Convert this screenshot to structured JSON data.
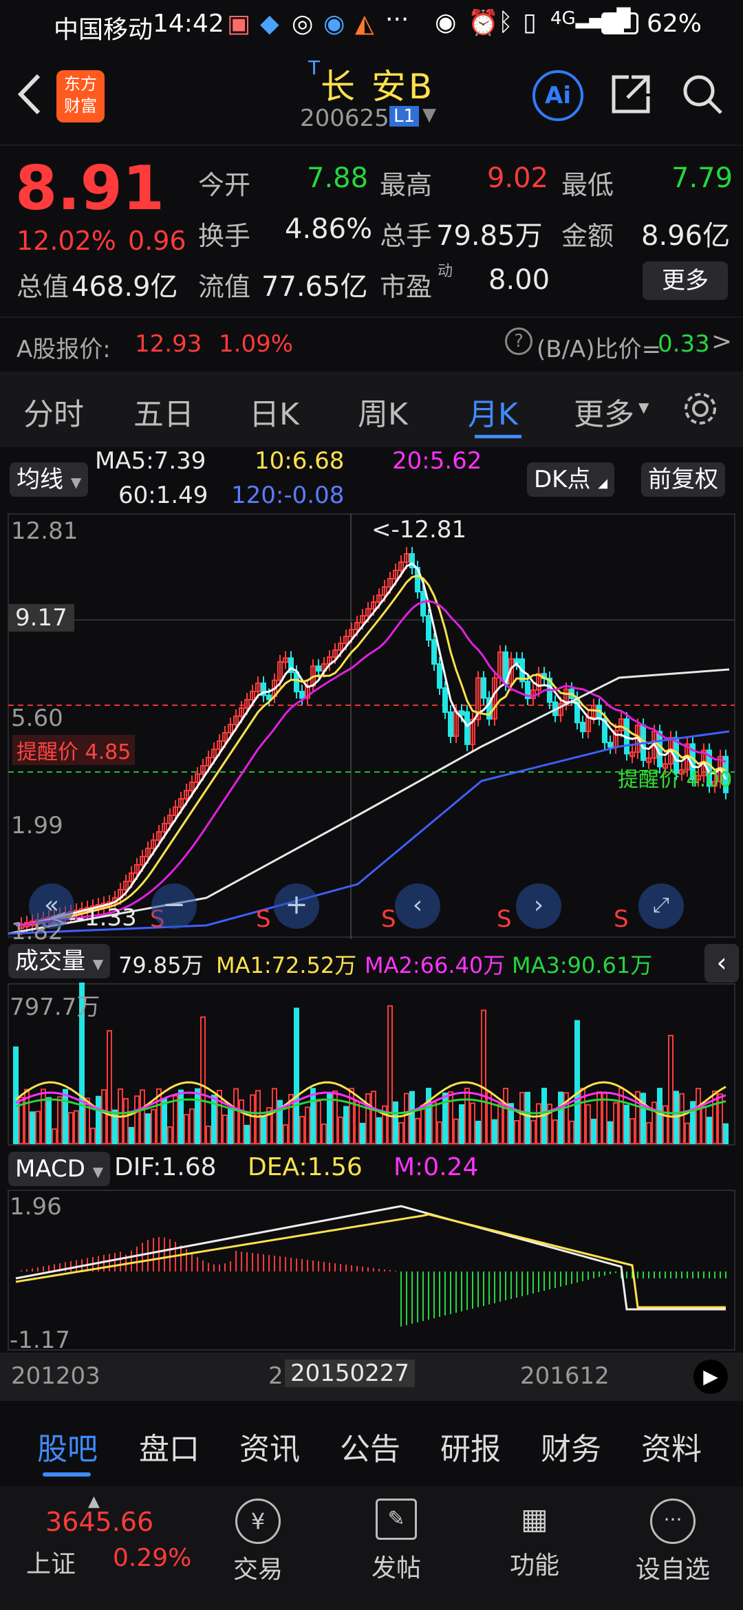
{
  "status": {
    "carrier": "中国移动",
    "time": "14:42",
    "battery": "62%"
  },
  "header": {
    "logo_line1": "东方",
    "logo_line2": "财富",
    "title": "长 安B",
    "title_prefix": "T",
    "code": "200625",
    "board": "L1",
    "ai_label": "Ai"
  },
  "quote": {
    "price": "8.91",
    "pct": "12.02%",
    "chg": "0.96",
    "open_label": "今开",
    "open": "7.88",
    "high_label": "最高",
    "high": "9.02",
    "low_label": "最低",
    "low": "7.79",
    "turnover_label": "换手",
    "turnover": "4.86%",
    "vol_label": "总手",
    "vol": "79.85万",
    "amount_label": "金额",
    "amount": "8.96亿",
    "mcap_label": "总值",
    "mcap": "468.9亿",
    "float_label": "流值",
    "float": "77.65亿",
    "pe_label": "市盈",
    "pe_sup": "动",
    "pe": "8.00",
    "more": "更多",
    "a_label": "A股报价:",
    "a_price": "12.93",
    "a_pct": "1.09%",
    "ba_label": "(B/A)比价=",
    "ba_value": "0.33"
  },
  "tabs": [
    "分时",
    "五日",
    "日K",
    "周K",
    "月K",
    "更多"
  ],
  "active_tab": "月K",
  "ma": {
    "chip": "均线",
    "ma5": "MA5:7.39",
    "ma10": "10:6.68",
    "ma20": "20:5.62",
    "ma60": "60:1.49",
    "ma120": "120:-0.08",
    "dk": "DK点",
    "fq": "前复权"
  },
  "kchart": {
    "y1": "12.81",
    "y2": "9.17",
    "y3": "5.60",
    "y4": "1.99",
    "y5": "1.82",
    "max_label": "<-12.81",
    "min_label": "<--1.33",
    "alert_red": "提醒价 4.85",
    "alert_green": "提醒价 4.00",
    "s": "S"
  },
  "volume": {
    "chip": "成交量",
    "v": "79.85万",
    "ma1": "MA1:72.52万",
    "ma2": "MA2:66.40万",
    "ma3": "MA3:90.61万",
    "ymax": "797.7万"
  },
  "macd": {
    "chip": "MACD",
    "dif": "DIF:1.68",
    "dea": "DEA:1.56",
    "m": "M:0.24",
    "ymax": "1.96",
    "ymin": "-1.17"
  },
  "xaxis": {
    "d1": "201203",
    "d2": "2",
    "d3": "20150227",
    "d4": "201612"
  },
  "bottom_tabs": [
    "股吧",
    "盘口",
    "资讯",
    "公告",
    "研报",
    "财务",
    "资料"
  ],
  "footer": {
    "index_name": "上证",
    "index_val": "3645.66",
    "index_pct": "0.29%",
    "items": [
      "交易",
      "发帖",
      "功能",
      "设自选"
    ]
  }
}
